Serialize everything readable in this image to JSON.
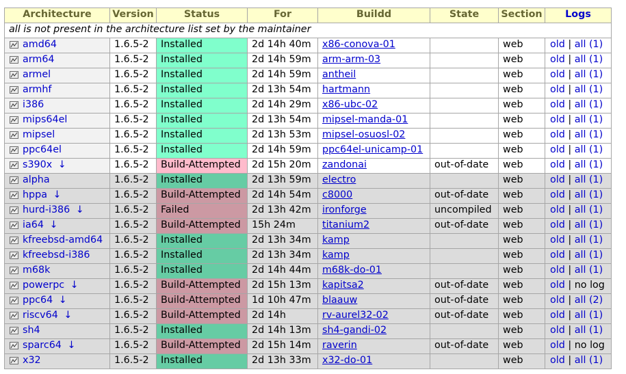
{
  "headers": {
    "architecture": "Architecture",
    "version": "Version",
    "status": "Status",
    "for": "For",
    "buildd": "Buildd",
    "state": "State",
    "section": "Section",
    "logs": "Logs"
  },
  "note": "all is not present in the architecture list set by the maintainer",
  "log_sep": "|",
  "rows": [
    {
      "arch": "amd64",
      "arrow": "",
      "version": "1.6.5-2",
      "status": "Installed",
      "for": "2d 14h 40m",
      "buildd": "x86-conova-01",
      "state": "",
      "section": "web",
      "old": "old",
      "all": "all (1)",
      "nolog": ""
    },
    {
      "arch": "arm64",
      "arrow": "",
      "version": "1.6.5-2",
      "status": "Installed",
      "for": "2d 14h 59m",
      "buildd": "arm-arm-03",
      "state": "",
      "section": "web",
      "old": "old",
      "all": "all (1)",
      "nolog": ""
    },
    {
      "arch": "armel",
      "arrow": "",
      "version": "1.6.5-2",
      "status": "Installed",
      "for": "2d 14h 59m",
      "buildd": "antheil",
      "state": "",
      "section": "web",
      "old": "old",
      "all": "all (1)",
      "nolog": ""
    },
    {
      "arch": "armhf",
      "arrow": "",
      "version": "1.6.5-2",
      "status": "Installed",
      "for": "2d 13h 54m",
      "buildd": "hartmann",
      "state": "",
      "section": "web",
      "old": "old",
      "all": "all (1)",
      "nolog": ""
    },
    {
      "arch": "i386",
      "arrow": "",
      "version": "1.6.5-2",
      "status": "Installed",
      "for": "2d 14h 29m",
      "buildd": "x86-ubc-02",
      "state": "",
      "section": "web",
      "old": "old",
      "all": "all (1)",
      "nolog": ""
    },
    {
      "arch": "mips64el",
      "arrow": "",
      "version": "1.6.5-2",
      "status": "Installed",
      "for": "2d 13h 54m",
      "buildd": "mipsel-manda-01",
      "state": "",
      "section": "web",
      "old": "old",
      "all": "all (1)",
      "nolog": ""
    },
    {
      "arch": "mipsel",
      "arrow": "",
      "version": "1.6.5-2",
      "status": "Installed",
      "for": "2d 13h 53m",
      "buildd": "mipsel-osuosl-02",
      "state": "",
      "section": "web",
      "old": "old",
      "all": "all (1)",
      "nolog": ""
    },
    {
      "arch": "ppc64el",
      "arrow": "",
      "version": "1.6.5-2",
      "status": "Installed",
      "for": "2d 14h 59m",
      "buildd": "ppc64el-unicamp-01",
      "state": "",
      "section": "web",
      "old": "old",
      "all": "all (1)",
      "nolog": ""
    },
    {
      "arch": "s390x",
      "arrow": "↓",
      "version": "1.6.5-2",
      "status": "Build-Attempted",
      "for": "2d 15h 20m",
      "buildd": "zandonai",
      "state": "out-of-date",
      "section": "web",
      "old": "old",
      "all": "all (1)",
      "nolog": ""
    },
    {
      "arch": "alpha",
      "arrow": "",
      "version": "1.6.5-2",
      "status": "Installed",
      "for": "2d 13h 59m",
      "buildd": "electro",
      "state": "",
      "section": "web",
      "old": "old",
      "all": "all (1)",
      "nolog": ""
    },
    {
      "arch": "hppa",
      "arrow": "↓",
      "version": "1.6.5-2",
      "status": "Build-Attempted",
      "for": "2d 14h 54m",
      "buildd": "c8000",
      "state": "out-of-date",
      "section": "web",
      "old": "old",
      "all": "all (1)",
      "nolog": ""
    },
    {
      "arch": "hurd-i386",
      "arrow": "↓",
      "version": "1.6.5-2",
      "status": "Failed",
      "for": "2d 13h 42m",
      "buildd": "ironforge",
      "state": "uncompiled",
      "section": "web",
      "old": "old",
      "all": "all (1)",
      "nolog": ""
    },
    {
      "arch": "ia64",
      "arrow": "↓",
      "version": "1.6.5-2",
      "status": "Build-Attempted",
      "for": "15h 24m",
      "buildd": "titanium2",
      "state": "out-of-date",
      "section": "web",
      "old": "old",
      "all": "all (1)",
      "nolog": ""
    },
    {
      "arch": "kfreebsd-amd64",
      "arrow": "",
      "version": "1.6.5-2",
      "status": "Installed",
      "for": "2d 13h 34m",
      "buildd": "kamp",
      "state": "",
      "section": "web",
      "old": "old",
      "all": "all (1)",
      "nolog": ""
    },
    {
      "arch": "kfreebsd-i386",
      "arrow": "",
      "version": "1.6.5-2",
      "status": "Installed",
      "for": "2d 13h 34m",
      "buildd": "kamp",
      "state": "",
      "section": "web",
      "old": "old",
      "all": "all (1)",
      "nolog": ""
    },
    {
      "arch": "m68k",
      "arrow": "",
      "version": "1.6.5-2",
      "status": "Installed",
      "for": "2d 14h 44m",
      "buildd": "m68k-do-01",
      "state": "",
      "section": "web",
      "old": "old",
      "all": "all (1)",
      "nolog": ""
    },
    {
      "arch": "powerpc",
      "arrow": "↓",
      "version": "1.6.5-2",
      "status": "Build-Attempted",
      "for": "2d 15h 13m",
      "buildd": "kapitsa2",
      "state": "out-of-date",
      "section": "web",
      "old": "old",
      "all": "",
      "nolog": "no log"
    },
    {
      "arch": "ppc64",
      "arrow": "↓",
      "version": "1.6.5-2",
      "status": "Build-Attempted",
      "for": "1d 10h 47m",
      "buildd": "blaauw",
      "state": "out-of-date",
      "section": "web",
      "old": "old",
      "all": "all (2)",
      "nolog": ""
    },
    {
      "arch": "riscv64",
      "arrow": "↓",
      "version": "1.6.5-2",
      "status": "Build-Attempted",
      "for": "2d 14h",
      "buildd": "rv-aurel32-02",
      "state": "out-of-date",
      "section": "web",
      "old": "old",
      "all": "all (1)",
      "nolog": ""
    },
    {
      "arch": "sh4",
      "arrow": "",
      "version": "1.6.5-2",
      "status": "Installed",
      "for": "2d 14h 13m",
      "buildd": "sh4-gandi-02",
      "state": "",
      "section": "web",
      "old": "old",
      "all": "all (1)",
      "nolog": ""
    },
    {
      "arch": "sparc64",
      "arrow": "↓",
      "version": "1.6.5-2",
      "status": "Build-Attempted",
      "for": "2d 15h 14m",
      "buildd": "raverin",
      "state": "out-of-date",
      "section": "web",
      "old": "old",
      "all": "",
      "nolog": "no log"
    },
    {
      "arch": "x32",
      "arrow": "",
      "version": "1.6.5-2",
      "status": "Installed",
      "for": "2d 13h 33m",
      "buildd": "x32-do-01",
      "state": "",
      "section": "web",
      "old": "old",
      "all": "all (1)",
      "nolog": ""
    }
  ],
  "colors": {
    "header_bg": "#ffffcc",
    "header_text": "#666633",
    "link": "#0000cc",
    "installed_official": "#80ffcc",
    "attempted_official": "#ffbbcc",
    "installed_port": "#66cca4",
    "attempted_port": "#cc99a3",
    "row_official": "#f2f2f2",
    "row_port": "#dcdcdc"
  },
  "icon": "graph-icon"
}
